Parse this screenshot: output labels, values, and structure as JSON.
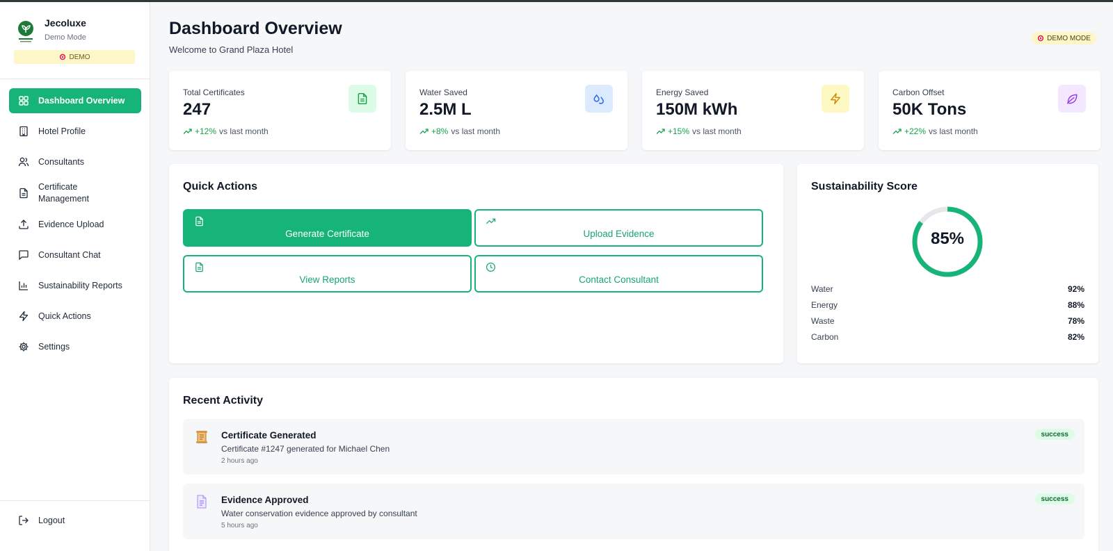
{
  "brand": {
    "name": "Jecoluxe",
    "mode": "Demo Mode",
    "demo_pill": "DEMO"
  },
  "sidebar": {
    "items": [
      {
        "label": "Dashboard Overview",
        "icon": "grid-icon",
        "active": true
      },
      {
        "label": "Hotel Profile",
        "icon": "building-icon"
      },
      {
        "label": "Consultants",
        "icon": "users-icon"
      },
      {
        "label": "Certificate\nManagement",
        "icon": "file-icon"
      },
      {
        "label": "Evidence Upload",
        "icon": "upload-icon"
      },
      {
        "label": "Consultant Chat",
        "icon": "chat-icon"
      },
      {
        "label": "Sustainability Reports",
        "icon": "bar-chart-icon"
      },
      {
        "label": "Quick Actions",
        "icon": "zap-icon"
      },
      {
        "label": "Settings",
        "icon": "gear-icon"
      }
    ],
    "logout": "Logout"
  },
  "header": {
    "title": "Dashboard Overview",
    "subtitle": "Welcome to Grand Plaza Hotel",
    "demo_badge": "DEMO MODE"
  },
  "stats": [
    {
      "label": "Total Certificates",
      "value": "247",
      "trend": "+12%",
      "trend_suffix": "vs last month",
      "icon": "file-icon",
      "icon_bg": "#dcfce7",
      "icon_color": "#16a34a"
    },
    {
      "label": "Water Saved",
      "value": "2.5M L",
      "trend": "+8%",
      "trend_suffix": "vs last month",
      "icon": "droplets-icon",
      "icon_bg": "#dbeafe",
      "icon_color": "#2563eb"
    },
    {
      "label": "Energy Saved",
      "value": "150M kWh",
      "trend": "+15%",
      "trend_suffix": "vs last month",
      "icon": "zap-icon",
      "icon_bg": "#fef9c3",
      "icon_color": "#ca8a04"
    },
    {
      "label": "Carbon Offset",
      "value": "50K Tons",
      "trend": "+22%",
      "trend_suffix": "vs last month",
      "icon": "leaf-icon",
      "icon_bg": "#f3e8ff",
      "icon_color": "#9333ea"
    }
  ],
  "quick_actions": {
    "title": "Quick Actions",
    "buttons": [
      {
        "label": "Generate Certificate",
        "icon": "file-icon",
        "primary": true
      },
      {
        "label": "Upload Evidence",
        "icon": "trending-up-icon"
      },
      {
        "label": "View Reports",
        "icon": "file-icon"
      },
      {
        "label": "Contact Consultant",
        "icon": "clock-icon"
      }
    ]
  },
  "sustainability": {
    "title": "Sustainability Score",
    "score": "85%",
    "score_fraction": 0.85,
    "metrics": [
      {
        "name": "Water",
        "value": "92%"
      },
      {
        "name": "Energy",
        "value": "88%"
      },
      {
        "name": "Waste",
        "value": "78%"
      },
      {
        "name": "Carbon",
        "value": "82%"
      }
    ]
  },
  "recent_activity": {
    "title": "Recent Activity",
    "items": [
      {
        "title": "Certificate Generated",
        "description": "Certificate #1247 generated for Michael Chen",
        "time": "2 hours ago",
        "status": "success",
        "icon": "scroll-icon"
      },
      {
        "title": "Evidence Approved",
        "description": "Water conservation evidence approved by consultant",
        "time": "5 hours ago",
        "status": "success",
        "icon": "document-icon"
      }
    ]
  },
  "colors": {
    "accent": "#17b47a",
    "demo_bg": "#fdf6c9",
    "success_bg": "#dcfce7"
  }
}
